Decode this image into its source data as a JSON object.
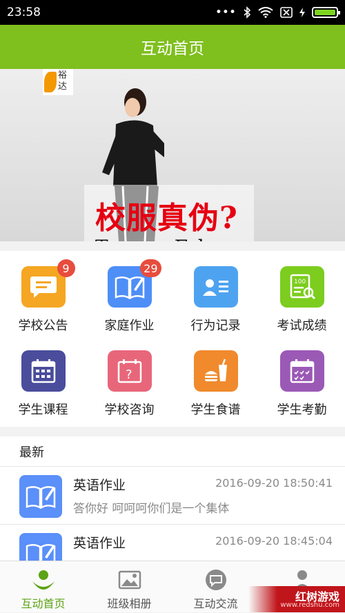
{
  "status_bar": {
    "time": "23:58"
  },
  "header": {
    "title": "互动首页"
  },
  "banner": {
    "logo_text": "裕达",
    "title": "校服真伪?",
    "subtitle": "True or False",
    "slides": 3,
    "active_slide": 0
  },
  "grid": {
    "items": [
      {
        "label": "学校公告",
        "badge": "9",
        "color": "#f5a623",
        "icon": "message-icon"
      },
      {
        "label": "家庭作业",
        "badge": "29",
        "color": "#4e8ef7",
        "icon": "book-icon"
      },
      {
        "label": "行为记录",
        "badge": "",
        "color": "#4ea3f1",
        "icon": "id-card-icon"
      },
      {
        "label": "考试成绩",
        "badge": "",
        "color": "#7ccd1e",
        "icon": "score-sheet-icon"
      },
      {
        "label": "学生课程",
        "badge": "",
        "color": "#4a4d9c",
        "icon": "calendar-icon"
      },
      {
        "label": "学校咨询",
        "badge": "",
        "color": "#e8667a",
        "icon": "question-calendar-icon"
      },
      {
        "label": "学生食谱",
        "badge": "",
        "color": "#f08a2c",
        "icon": "food-icon"
      },
      {
        "label": "学生考勤",
        "badge": "",
        "color": "#9b59b6",
        "icon": "attendance-calendar-icon"
      }
    ]
  },
  "news": {
    "title": "最新",
    "items": [
      {
        "name": "英语作业",
        "date": "2016-09-20 18:50:41",
        "desc": "答你好 呵呵呵你们是一个集体"
      },
      {
        "name": "英语作业",
        "date": "2016-09-20 18:45:04",
        "desc": ""
      }
    ]
  },
  "tabbar": {
    "tabs": [
      {
        "label": "互动首页",
        "active": true
      },
      {
        "label": "班级相册",
        "active": false
      },
      {
        "label": "互动交流",
        "active": false
      },
      {
        "label": "",
        "active": false
      }
    ]
  },
  "watermark": {
    "text": "红树游戏",
    "url": "www.redshu.com"
  },
  "colors": {
    "accent": "#7fbf1e",
    "active_tab": "#5ca315"
  }
}
